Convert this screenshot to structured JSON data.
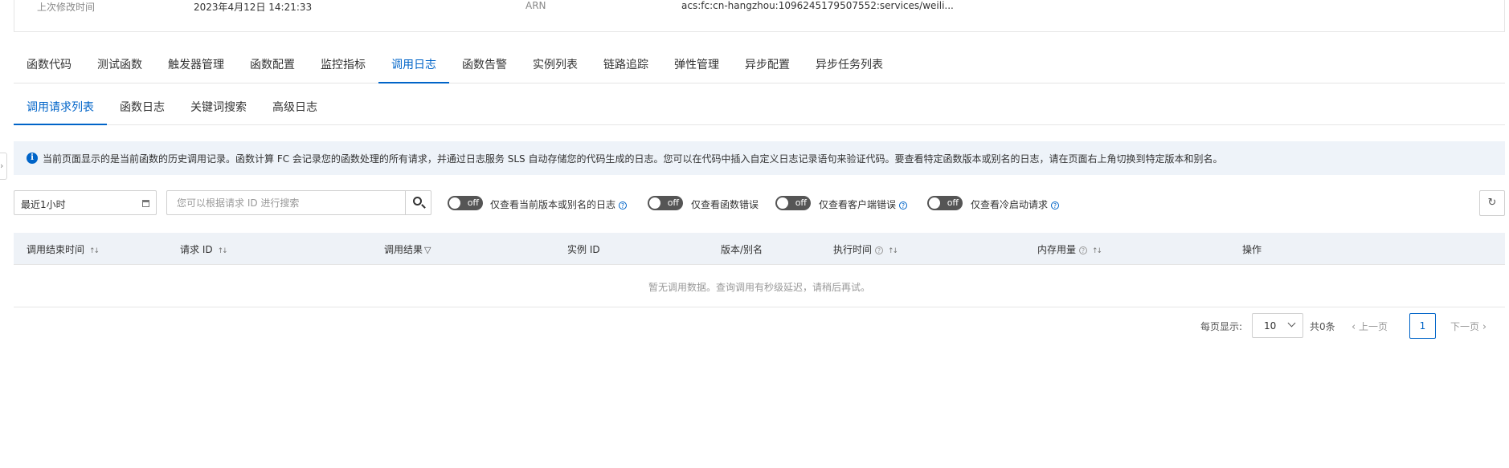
{
  "info": {
    "modified_label": "上次修改时间",
    "modified_value": "2023年4月12日 14:21:33",
    "arn_label": "ARN",
    "arn_value": "acs:fc:cn-hangzhou:1096245179507552:services/weili..."
  },
  "tabs": [
    {
      "label": "函数代码",
      "active": false
    },
    {
      "label": "测试函数",
      "active": false
    },
    {
      "label": "触发器管理",
      "active": false
    },
    {
      "label": "函数配置",
      "active": false
    },
    {
      "label": "监控指标",
      "active": false
    },
    {
      "label": "调用日志",
      "active": true
    },
    {
      "label": "函数告警",
      "active": false
    },
    {
      "label": "实例列表",
      "active": false
    },
    {
      "label": "链路追踪",
      "active": false
    },
    {
      "label": "弹性管理",
      "active": false
    },
    {
      "label": "异步配置",
      "active": false
    },
    {
      "label": "异步任务列表",
      "active": false
    }
  ],
  "subtabs": [
    {
      "label": "调用请求列表",
      "active": true
    },
    {
      "label": "函数日志",
      "active": false
    },
    {
      "label": "关键词搜索",
      "active": false
    },
    {
      "label": "高级日志",
      "active": false
    }
  ],
  "notice": {
    "icon": "info-icon",
    "text": "当前页面显示的是当前函数的历史调用记录。函数计算 FC 会记录您的函数处理的所有请求，并通过日志服务 SLS 自动存储您的代码生成的日志。您可以在代码中插入自定义日志记录语句来验证代码。要查看特定函数版本或别名的日志，请在页面右上角切换到特定版本和别名。"
  },
  "filters": {
    "time_range": "最近1小时",
    "search_placeholder": "您可以根据请求 ID 进行搜索",
    "toggles": [
      {
        "state": "off",
        "label": "仅查看当前版本或别名的日志",
        "help": true
      },
      {
        "state": "off",
        "label": "仅查看函数错误",
        "help": false
      },
      {
        "state": "off",
        "label": "仅查看客户端错误",
        "help": true
      },
      {
        "state": "off",
        "label": "仅查看冷启动请求",
        "help": true
      }
    ]
  },
  "table": {
    "columns": {
      "end_time": "调用结束时间",
      "request_id": "请求 ID",
      "result": "调用结果",
      "instance_id": "实例 ID",
      "version": "版本/别名",
      "exec_time": "执行时间",
      "memory": "内存用量",
      "actions": "操作"
    },
    "empty_text": "暂无调用数据。查询调用有秒级延迟，请稍后再试。"
  },
  "pagination": {
    "per_page_label": "每页显示:",
    "page_size": "10",
    "total": "共0条",
    "prev": "上一页",
    "current_page": "1",
    "next": "下一页"
  },
  "colors": {
    "accent": "#0064c8",
    "notice_bg": "#eef3f9",
    "header_bg": "#eef2f7",
    "toggle_off": "#555555"
  }
}
